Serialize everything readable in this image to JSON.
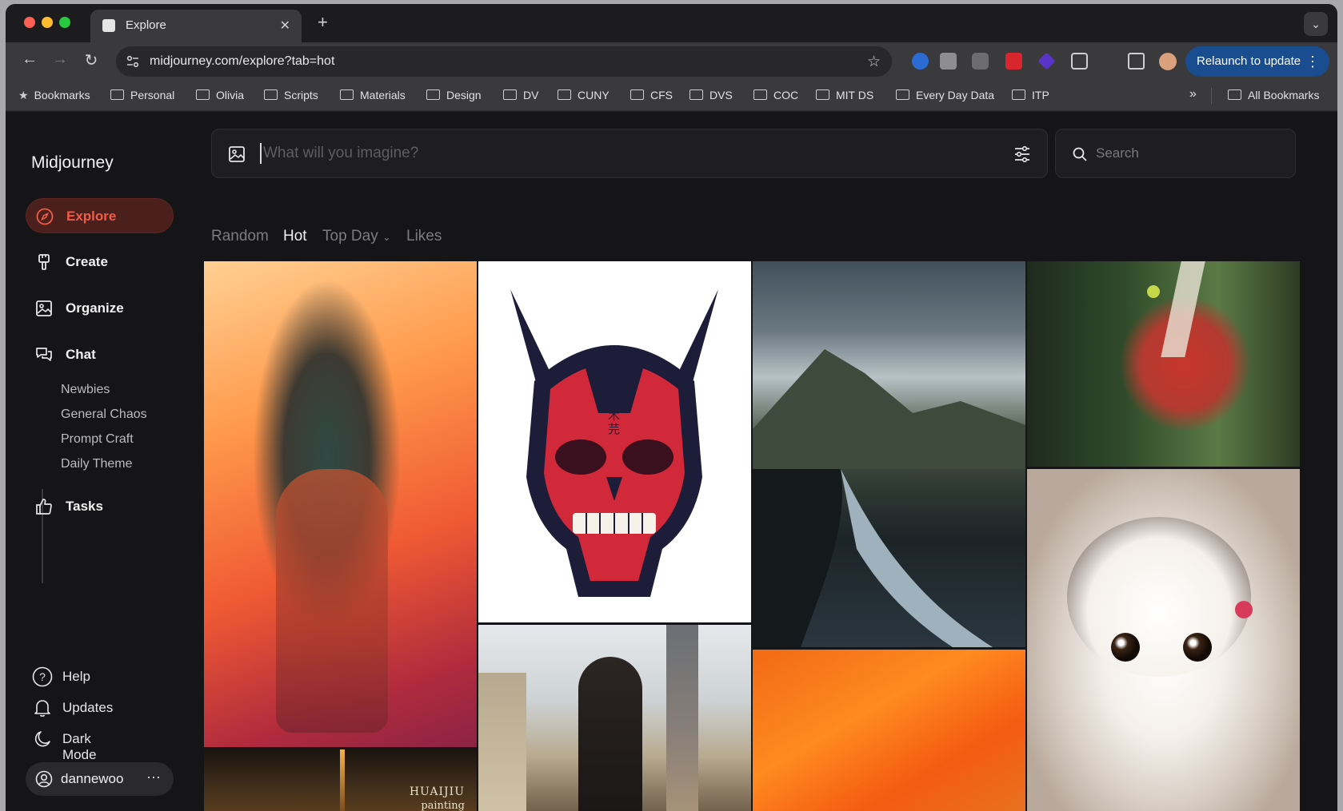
{
  "browser": {
    "tab_title": "Explore",
    "url": "midjourney.com/explore?tab=hot",
    "relaunch_label": "Relaunch to update",
    "bookmarks_label": "Bookmarks",
    "bookmark_folders": [
      "Personal",
      "Olivia",
      "Scripts",
      "Materials",
      "Design",
      "DV",
      "CUNY",
      "CFS",
      "DVS",
      "COC",
      "MIT DS",
      "Every Day Data",
      "ITP"
    ],
    "all_bookmarks_label": "All Bookmarks",
    "overflow_label": "»"
  },
  "sidebar": {
    "brand": "Midjourney",
    "nav": [
      {
        "label": "Explore",
        "icon": "compass-icon"
      },
      {
        "label": "Create",
        "icon": "brush-icon"
      },
      {
        "label": "Organize",
        "icon": "image-icon"
      },
      {
        "label": "Chat",
        "icon": "chat-icon"
      }
    ],
    "channels": [
      "Newbies",
      "General Chaos",
      "Prompt Craft",
      "Daily Theme"
    ],
    "tasks_label": "Tasks",
    "help_label": "Help",
    "updates_label": "Updates",
    "dark_mode_label": "Dark Mode",
    "username": "dannewoo",
    "user_menu": "···"
  },
  "main": {
    "prompt_placeholder": "What will you imagine?",
    "search_placeholder": "Search",
    "filter_tabs": [
      "Random",
      "Hot",
      "Top Day",
      "Likes"
    ],
    "active_tab": "Hot",
    "gallery_caption_line1": "HUAIJIU",
    "gallery_caption_line2": "painting",
    "mask_glyph": "木\n芫"
  },
  "colors": {
    "accent": "#f25c47",
    "active_bg": "#4a1f1c",
    "relaunch_bg": "#1a4d8f"
  }
}
